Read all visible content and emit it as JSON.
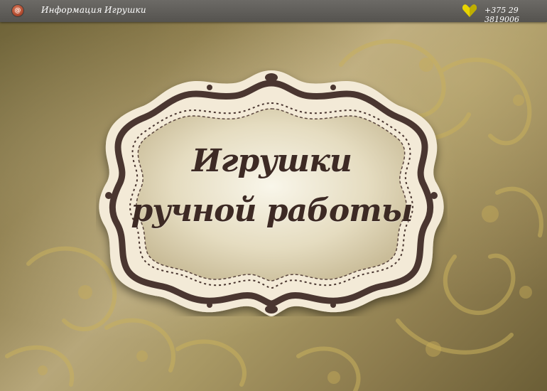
{
  "nav": {
    "logo_glyph": "@",
    "links": [
      {
        "label": "Информация"
      },
      {
        "label": "Игрушки"
      }
    ],
    "phone_icon": "heart-icon",
    "phone": "+375 29 3819006"
  },
  "hero": {
    "title_line1": "Игрушки",
    "title_line2": "ручной работы"
  },
  "colors": {
    "topbar": "#5e5c58",
    "title": "#3d2a24",
    "frame_cream": "#f3ead7",
    "ornament": "#4a3630",
    "accent_yellow": "#e8d400"
  }
}
